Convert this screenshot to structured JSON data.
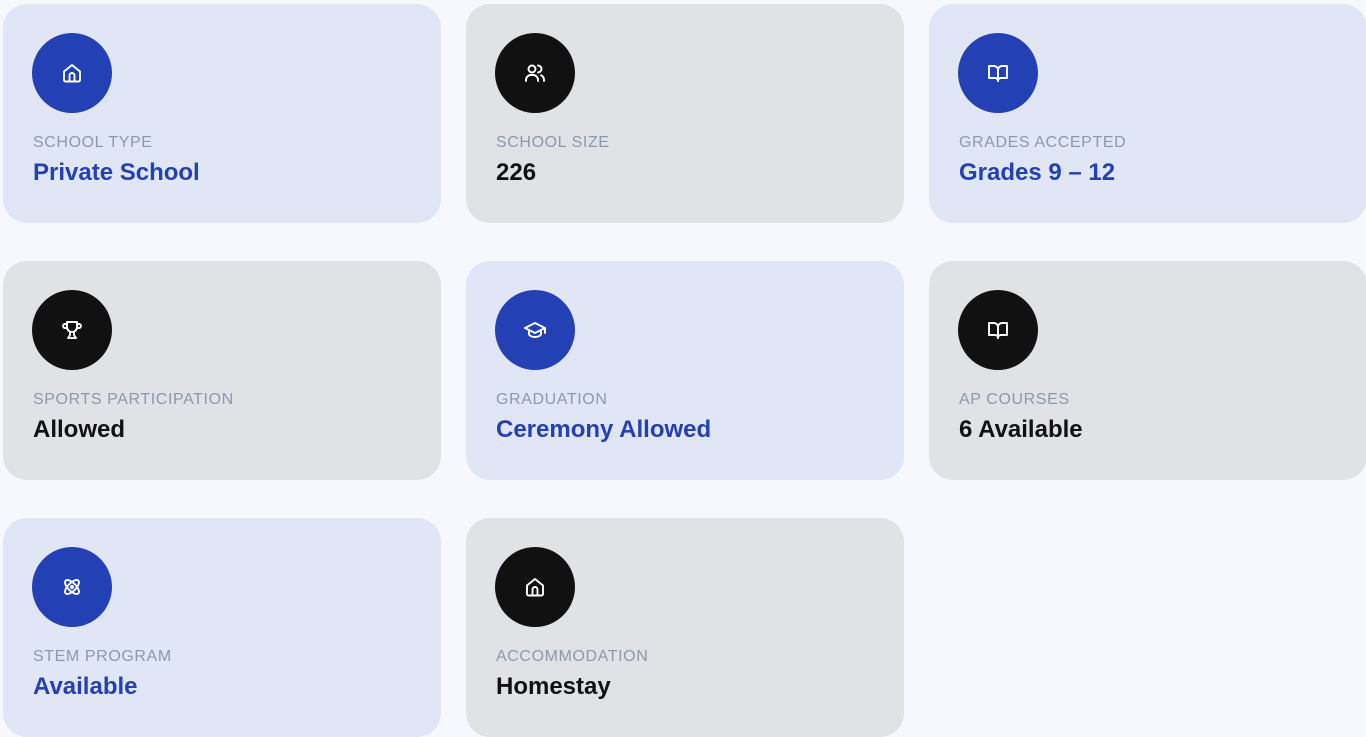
{
  "colors": {
    "accent_blue": "#2340b4",
    "dark": "#111111",
    "card_blue_bg": "#e1e6f6",
    "card_gray_bg": "#e1e2e6",
    "label_gray": "#8c98ad",
    "page_bg": "#f6f8fd"
  },
  "cards": [
    {
      "label": "SCHOOL TYPE",
      "value": "Private School",
      "icon": "home-icon",
      "theme": "blue"
    },
    {
      "label": "SCHOOL SIZE",
      "value": "226",
      "icon": "users-icon",
      "theme": "dark"
    },
    {
      "label": "GRADES ACCEPTED",
      "value": "Grades 9 – 12",
      "icon": "book-open-icon",
      "theme": "blue"
    },
    {
      "label": "SPORTS PARTICIPATION",
      "value": "Allowed",
      "icon": "trophy-icon",
      "theme": "dark"
    },
    {
      "label": "GRADUATION",
      "value": "Ceremony Allowed",
      "icon": "graduation-cap-icon",
      "theme": "blue"
    },
    {
      "label": "AP COURSES",
      "value": "6 Available",
      "icon": "book-open-icon",
      "theme": "dark"
    },
    {
      "label": "STEM PROGRAM",
      "value": "Available",
      "icon": "atom-icon",
      "theme": "blue"
    },
    {
      "label": "ACCOMMODATION",
      "value": "Homestay",
      "icon": "home-icon",
      "theme": "dark"
    }
  ]
}
